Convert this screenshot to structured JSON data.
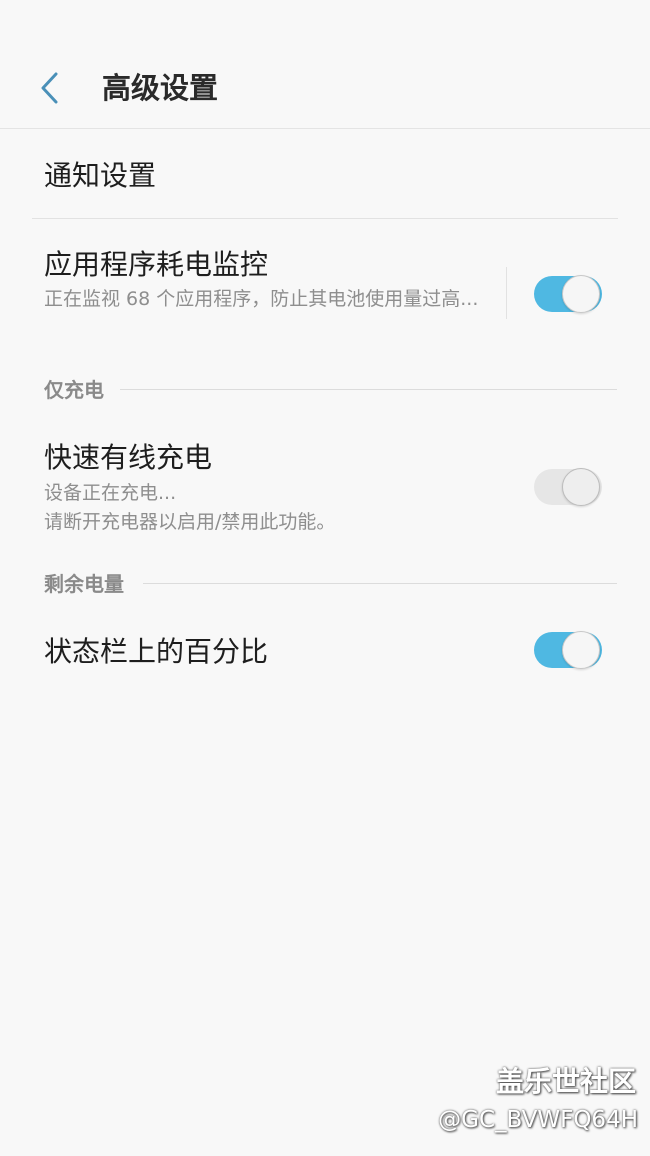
{
  "header": {
    "title": "高级设置",
    "back_icon": "chevron-left-icon",
    "accent_color": "#4a90b8"
  },
  "items": {
    "notification": {
      "title": "通知设置"
    },
    "app_power_monitor": {
      "title": "应用程序耗电监控",
      "subtitle": "正在监视 68 个应用程序，防止其电池使用量过高...",
      "toggle_on": true
    },
    "fast_wireless": {
      "title": "快速有线充电",
      "subtitle_line1": "设备正在充电...",
      "subtitle_line2": "请断开充电器以启用/禁用此功能。",
      "toggle_on": true,
      "toggle_enabled": false
    },
    "status_bar_percent": {
      "title": "状态栏上的百分比",
      "toggle_on": true
    }
  },
  "sections": {
    "charging_only": "仅充电",
    "remaining_power": "剩余电量"
  },
  "watermark": {
    "brand": "盖乐世社区",
    "user": "@GC_BVWFQ64H"
  },
  "colors": {
    "toggle_on": "#4fb8e2",
    "toggle_disabled": "#e6e6e6",
    "background": "#f8f8f8"
  }
}
